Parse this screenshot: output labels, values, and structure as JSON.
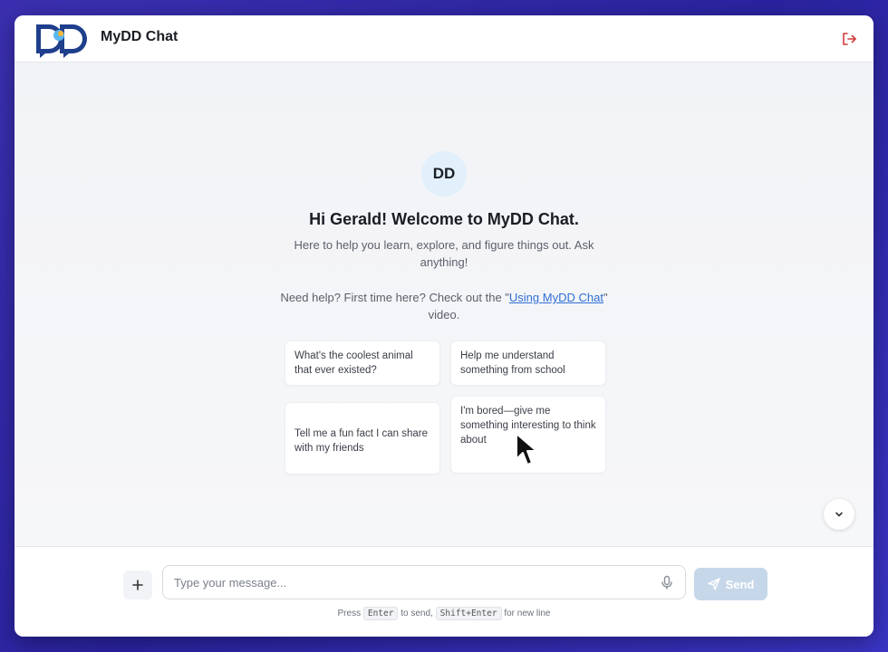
{
  "header": {
    "title": "MyDD Chat",
    "logo_text": "DD",
    "logout_icon": "logout-icon"
  },
  "welcome": {
    "avatar": "DD",
    "heading": "Hi Gerald! Welcome to MyDD Chat.",
    "subtitle": "Here to help you learn, explore, and figure things out. Ask anything!",
    "help_prefix": "Need help? First time here? Check out the \"",
    "help_link": "Using MyDD Chat",
    "help_suffix": "\" video."
  },
  "suggestions": [
    "What's the coolest animal that ever existed?",
    "Help me understand something from school",
    "Tell me a fun fact I can share with my friends",
    "I'm bored—give me something interesting to think about"
  ],
  "composer": {
    "placeholder": "Type your message...",
    "send_label": "Send",
    "hint_press": "Press",
    "hint_enter": "Enter",
    "hint_to_send": "to send,",
    "hint_shift_enter": "Shift+Enter",
    "hint_new_line": "for new line"
  },
  "colors": {
    "accent": "#2f6fd6",
    "send_disabled": "#c7d7ea",
    "logout": "#d23a3a",
    "avatar_bg": "#e1f0fb"
  }
}
